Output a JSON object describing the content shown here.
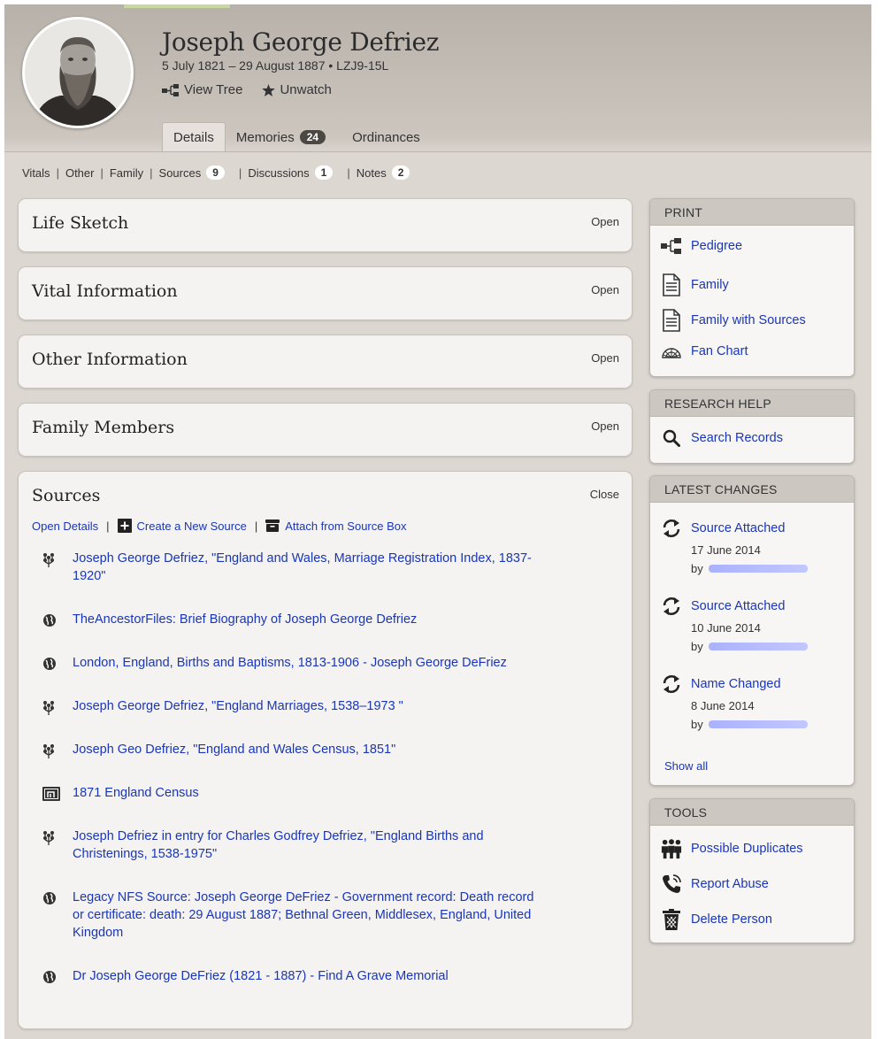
{
  "person": {
    "name": "Joseph George Defriez",
    "meta": "5 July 1821 – 29 August 1887 • LZJ9-15L",
    "view_tree": "View Tree",
    "unwatch": "Unwatch"
  },
  "main_tabs": [
    {
      "label": "Details",
      "active": true
    },
    {
      "label": "Memories",
      "badge": "24"
    },
    {
      "label": "Ordinances"
    }
  ],
  "sub_tabs": [
    {
      "label": "Vitals"
    },
    {
      "label": "Other"
    },
    {
      "label": "Family"
    },
    {
      "label": "Sources",
      "badge": "9"
    },
    {
      "label": "Discussions",
      "badge": "1"
    },
    {
      "label": "Notes",
      "badge": "2"
    }
  ],
  "sections": [
    {
      "title": "Life Sketch",
      "toggle": "Open"
    },
    {
      "title": "Vital Information",
      "toggle": "Open"
    },
    {
      "title": "Other Information",
      "toggle": "Open"
    },
    {
      "title": "Family Members",
      "toggle": "Open"
    }
  ],
  "sources": {
    "title": "Sources",
    "toggle": "Close",
    "open_details": "Open Details",
    "create_new": "Create a New Source",
    "attach_box": "Attach from Source Box",
    "items": [
      {
        "icon": "tree-icon",
        "text": "Joseph George Defriez, \"England and Wales, Marriage Registration Index, 1837-1920\""
      },
      {
        "icon": "globe-icon",
        "text": "TheAncestorFiles: Brief Biography of Joseph George Defriez"
      },
      {
        "icon": "globe-icon",
        "text": "London, England, Births and Baptisms, 1813-1906 - Joseph George DeFriez"
      },
      {
        "icon": "tree-icon",
        "text": "Joseph George Defriez, \"England Marriages, 1538–1973  \""
      },
      {
        "icon": "tree-icon",
        "text": "Joseph Geo Defriez, \"England and Wales Census, 1851\""
      },
      {
        "icon": "census-icon",
        "text": "1871 England Census"
      },
      {
        "icon": "tree-icon",
        "text": "Joseph Defriez in entry for Charles Godfrey Defriez, \"England Births and Christenings, 1538-1975\""
      },
      {
        "icon": "globe-icon",
        "text": "Legacy NFS Source: Joseph George DeFriez - Government record: Death record or certificate: death: 29 August 1887; Bethnal Green, Middlesex, England, United Kingdom"
      },
      {
        "icon": "globe-icon",
        "text": "Dr Joseph George DeFriez (1821 - 1887) - Find A Grave Memorial"
      }
    ]
  },
  "print": {
    "heading": "PRINT",
    "items": [
      {
        "icon": "pedigree-icon",
        "label": "Pedigree"
      },
      {
        "icon": "document-icon",
        "label": "Family"
      },
      {
        "icon": "document-icon",
        "label": "Family with Sources"
      },
      {
        "icon": "fan-chart-icon",
        "label": "Fan Chart"
      }
    ]
  },
  "research_help": {
    "heading": "RESEARCH HELP",
    "items": [
      {
        "icon": "search-icon",
        "label": "Search Records"
      }
    ]
  },
  "latest_changes": {
    "heading": "LATEST CHANGES",
    "items": [
      {
        "title": "Source Attached",
        "date": "17 June 2014",
        "by": "by"
      },
      {
        "title": "Source Attached",
        "date": "10 June 2014",
        "by": "by"
      },
      {
        "title": "Name Changed",
        "date": "8 June 2014",
        "by": "by"
      }
    ],
    "show_all": "Show all"
  },
  "tools": {
    "heading": "TOOLS",
    "items": [
      {
        "icon": "people-icon",
        "label": "Possible Duplicates"
      },
      {
        "icon": "phone-icon",
        "label": "Report Abuse"
      },
      {
        "icon": "trash-icon",
        "label": "Delete Person"
      }
    ]
  },
  "colors": {
    "link": "#1a36b8",
    "header_bg": "#b8b1aa",
    "page_bg": "#ddd7d1",
    "panel_bg": "#f4f3f2"
  }
}
